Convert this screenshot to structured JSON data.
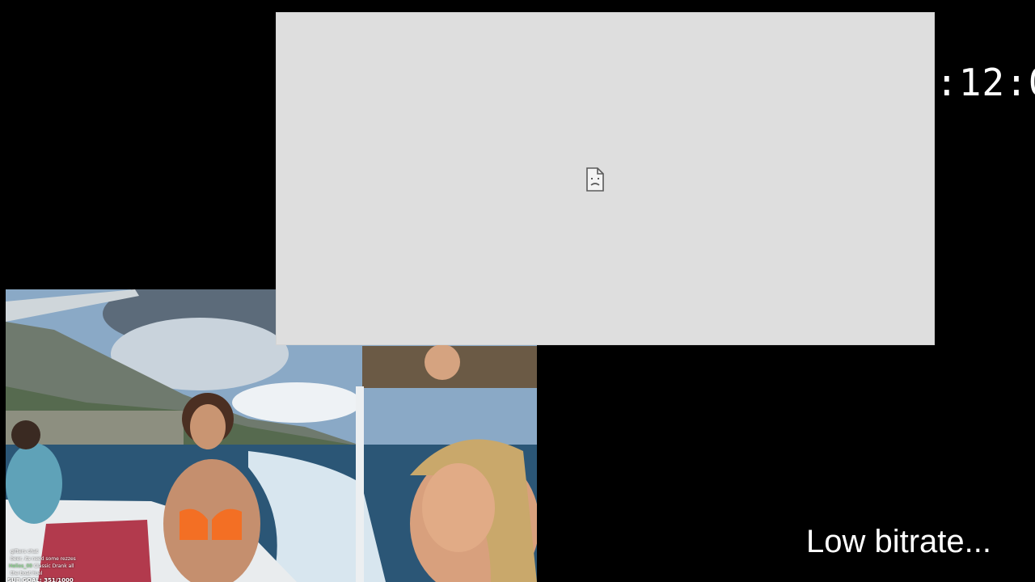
{
  "timer": {
    "text": ":12:0"
  },
  "status": {
    "low_bitrate": "Low bitrate..."
  },
  "broken_embed": {
    "icon": "broken-document-icon"
  },
  "video": {
    "chat": {
      "lines": [
        {
          "user": "",
          "message": "gifters chat"
        },
        {
          "user": "",
          "message": "beer, its need some rezzes"
        },
        {
          "user": "Helios_00",
          "message": "Classic Drank all"
        },
        {
          "user": "",
          "message": "the boat Fuel"
        }
      ],
      "sub_goal": "SUB GOAL: 351/1000"
    }
  },
  "colors": {
    "background": "#000000",
    "placeholder": "#dedede",
    "text": "#ffffff"
  }
}
